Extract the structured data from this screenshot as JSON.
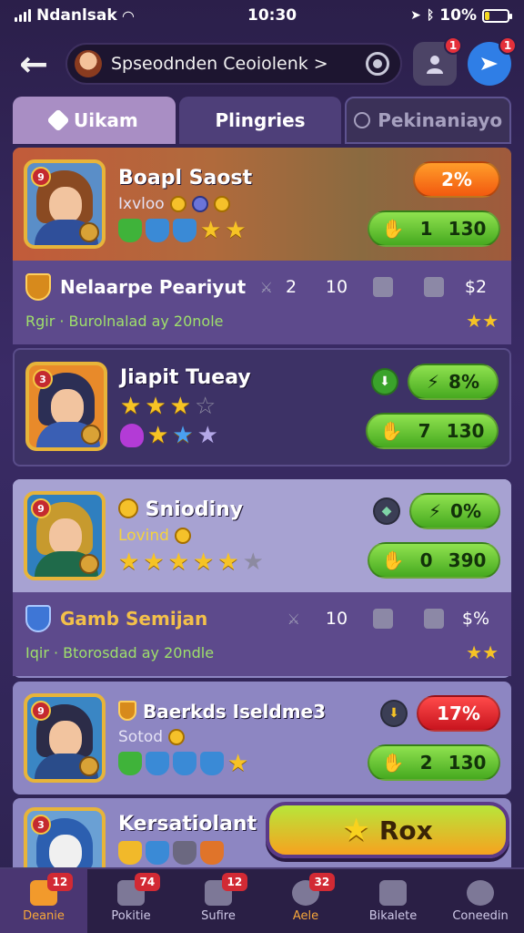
{
  "status_bar": {
    "carrier": "Ndanlsak",
    "time": "10:30",
    "battery": "10%"
  },
  "header": {
    "search_text": "Spseodnden Ceoiolenk >"
  },
  "header_badges": {
    "alerts": "1",
    "send": "1"
  },
  "tabs": [
    {
      "label": "Uikam"
    },
    {
      "label": "Plingries"
    },
    {
      "label": "Pekinaniayo"
    }
  ],
  "heroes": [
    {
      "name": "Boapl Saost",
      "sub": "Ixvloo",
      "pct": "2%",
      "action_a": "1",
      "action_b": "130",
      "level": "9",
      "stats": {
        "title": "Nelaarpe Peariyut",
        "a": "2",
        "b": "10",
        "c": "$2",
        "footer": "Rgir · Burolnalad ay 20nole"
      }
    },
    {
      "name": "Jiapit Tueay",
      "sub": "",
      "pct": "8%",
      "action_a": "7",
      "action_b": "130",
      "level": "3"
    },
    {
      "name": "Sniodiny",
      "sub": "Lovind",
      "pct": "0%",
      "action_a": "0",
      "action_b": "390",
      "level": "9",
      "stats": {
        "title": "Gamb Semijan",
        "a": "",
        "b": "10",
        "c": "$%",
        "footer": "Iqir · Btorosdad ay 20ndle"
      }
    },
    {
      "name": "Baerkds Iseldme3",
      "sub": "Sotod",
      "pct": "17%",
      "action_a": "2",
      "action_b": "130",
      "level": "9"
    },
    {
      "name": "Kersatiolant",
      "level": "3"
    }
  ],
  "rox_button": "Rox",
  "nav": [
    {
      "label": "Deanie",
      "badge": "12"
    },
    {
      "label": "Pokitie",
      "badge": "74"
    },
    {
      "label": "Sufire",
      "badge": "12"
    },
    {
      "label": "Aele",
      "badge": "32"
    },
    {
      "label": "Bikalete",
      "badge": ""
    },
    {
      "label": "Coneedin",
      "badge": ""
    }
  ],
  "colors": {
    "accent": "#f29a2c",
    "green": "#46a91f",
    "red": "#d22a34",
    "bg": "#2b1f4a"
  }
}
